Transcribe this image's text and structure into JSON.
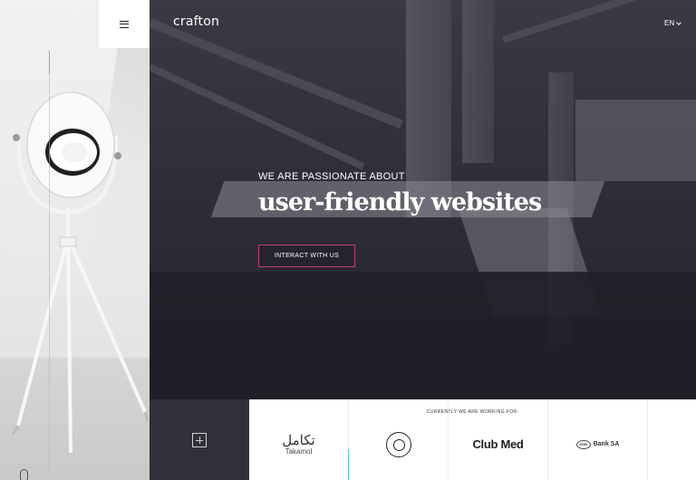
{
  "header": {
    "logo_text": "crafton",
    "language": "EN"
  },
  "hero": {
    "tagline": "WE ARE PASSIONATE ABOUT",
    "headline": "user-friendly websites",
    "cta_label": "INTERACT WITH US"
  },
  "clients": {
    "label": "CURRENTLY WE ARE WORKING FOR:",
    "items": [
      {
        "name": "Takamol",
        "arabic": "تكامل"
      },
      {
        "name": "emblem"
      },
      {
        "name": "Club Med"
      },
      {
        "name": "Bank SA",
        "mark": "SGB"
      }
    ]
  },
  "colors": {
    "accent_cyan": "#4ec3e0",
    "cta_border": "#c63a86",
    "hero_bg": "#2d2c36"
  },
  "icons": [
    "menu-icon",
    "chevron-down-icon",
    "plus-icon",
    "scroll-mouse-icon"
  ]
}
